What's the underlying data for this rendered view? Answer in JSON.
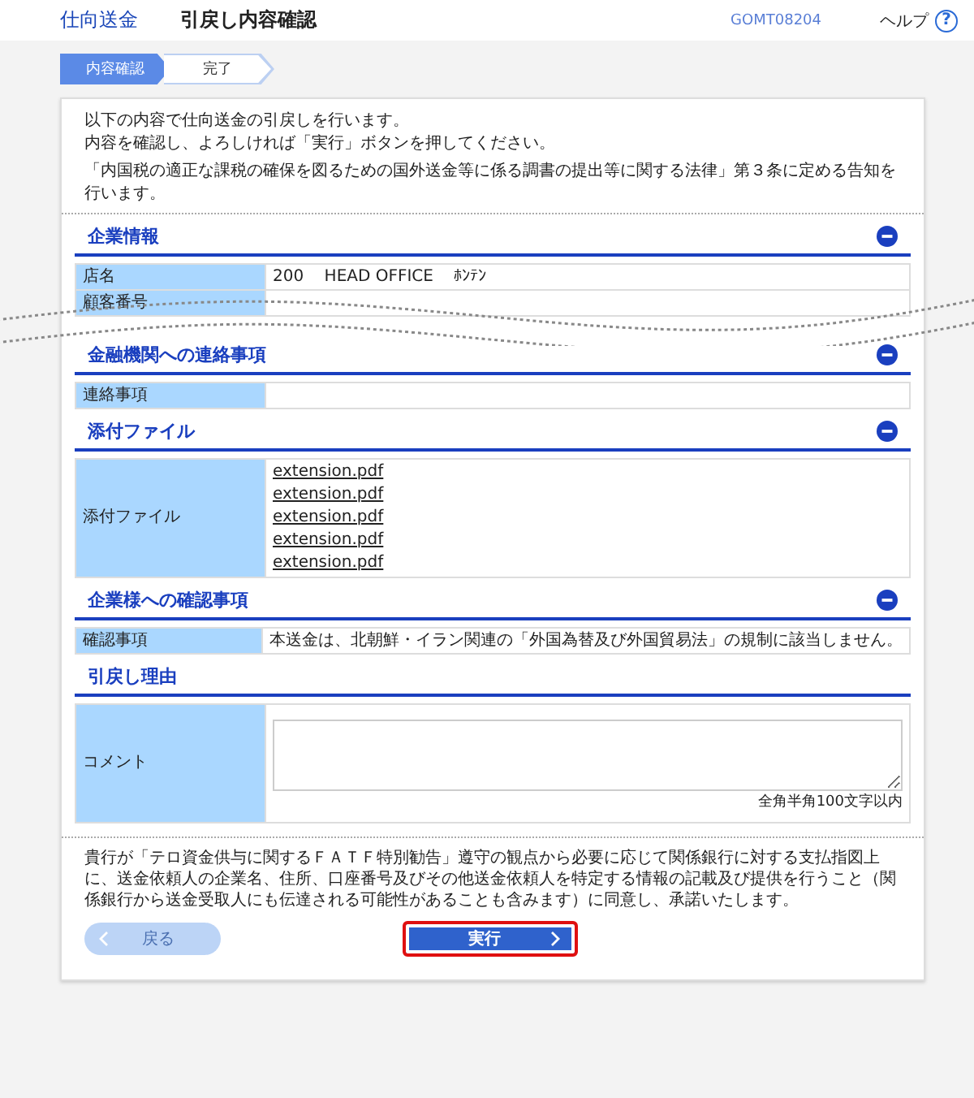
{
  "header": {
    "app_title": "仕向送金",
    "page_title": "引戻し内容確認",
    "screen_id": "GOMT08204",
    "help": "ヘルプ",
    "help_icon": "?"
  },
  "steps": [
    {
      "label": "内容確認",
      "selected": true
    },
    {
      "label": "完了",
      "selected": false
    }
  ],
  "intro": [
    "以下の内容で仕向送金の引戻しを行います。",
    "内容を確認し、よろしければ「実行」ボタンを押してください。",
    "「内国税の適正な課税の確保を図るための国外送金等に係る調書の提出等に関する法律」第３条に定める告知を行います。"
  ],
  "sections": [
    {
      "title": "企業情報",
      "collapsible": true,
      "cut_below": true,
      "rows": [
        {
          "kind": "text",
          "label": "店名",
          "value": "200    HEAD OFFICE    ﾎﾝﾃﾝ"
        },
        {
          "kind": "text",
          "label": "顧客番号"
        }
      ]
    },
    {
      "title": "金融機関への連絡事項",
      "collapsible": true,
      "cut_below": false,
      "rows": [
        {
          "kind": "text",
          "label": "連絡事項"
        }
      ]
    },
    {
      "title": "添付ファイル",
      "collapsible": true,
      "cut_below": false,
      "rows": [
        {
          "kind": "links",
          "label": "添付ファイル",
          "links": [
            "extension.pdf",
            "extension.pdf",
            "extension.pdf",
            "extension.pdf",
            "extension.pdf"
          ]
        }
      ]
    },
    {
      "title": "企業様への確認事項",
      "collapsible": true,
      "cut_below": false,
      "rows": [
        {
          "kind": "text",
          "label": "確認事項",
          "value": "本送金は、北朝鮮・イラン関連の「外国為替及び外国貿易法」の規制に該当しません。"
        }
      ]
    },
    {
      "title": "引戻し理由",
      "collapsible": false,
      "cut_below": false,
      "rows": [
        {
          "kind": "textarea",
          "label": "コメント",
          "note": "全角半角100文字以内"
        }
      ]
    }
  ],
  "consent": "貴行が「テロ資金供与に関するＦＡＴＦ特別勧告」遵守の観点から必要に応じて関係銀行に対する支払指図上に、送金依頼人の企業名、住所、口座番号及びその他送金依頼人を特定する情報の記載及び提供を行うこと（関係銀行から送金受取人にも伝達される可能性があることも含みます）に同意し、承諾いたします。",
  "buttons": [
    {
      "kind": "back",
      "label": "戻る",
      "disabled": true,
      "highlighted": false
    },
    {
      "kind": "execute",
      "label": "実行",
      "disabled": false,
      "highlighted": true
    }
  ]
}
